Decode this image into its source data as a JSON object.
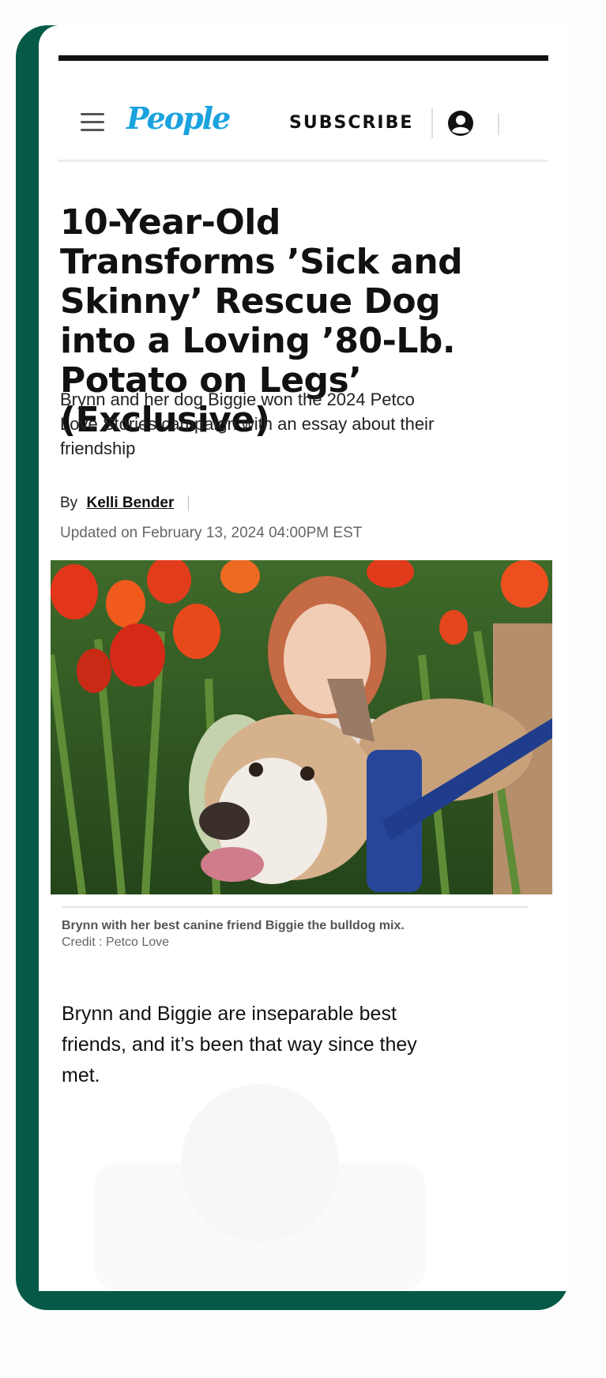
{
  "header": {
    "logo": "People",
    "subscribe_label": "SUBSCRIBE"
  },
  "article": {
    "headline": "10-Year-Old Transforms ’Sick and Skinny’ Rescue Dog into a Loving ’80-Lb. Potato on Legs’ (Exclusive)",
    "dek": "Brynn and her dog Biggie won the 2024 Petco Love Stories campaign with an essay about their friendship",
    "byline_prefix": "By",
    "author": "Kelli Bender",
    "updated": "Updated on February 13, 2024 04:00PM EST",
    "image_caption": "Brynn with her best canine friend Biggie the bulldog mix.",
    "image_credit": "Credit : Petco Love",
    "body_paragraph": "Brynn and Biggie are inseparable best friends, and it’s been that way since they met."
  },
  "icons": {
    "menu": "hamburger-menu-icon",
    "account": "user-circle-icon"
  },
  "colors": {
    "brand": "#1aa3df",
    "frame": "#055a47"
  }
}
